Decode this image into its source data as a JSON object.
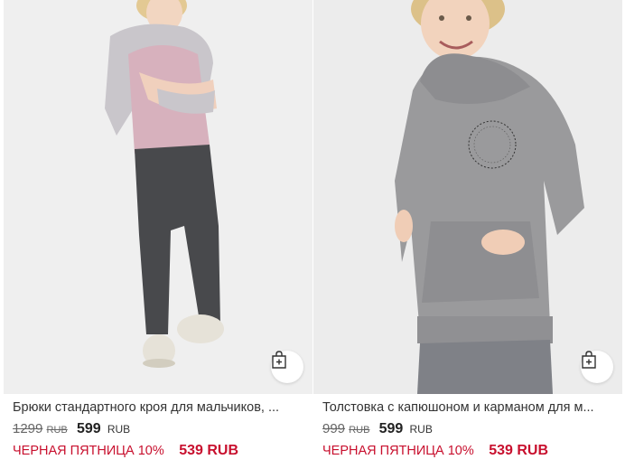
{
  "products": [
    {
      "title": "Брюки стандартного кроя для мальчиков, ...",
      "old_price": "1299",
      "old_currency": "RUB",
      "price": "599",
      "currency": "RUB",
      "promo_label": "ЧЕРНАЯ ПЯТНИЦА 10%",
      "promo_price": "539 RUB",
      "image_alt": "boy-in-pink-polo-and-dark-trousers"
    },
    {
      "title": "Толстовка с капюшоном и карманом для м...",
      "old_price": "999",
      "old_currency": "RUB",
      "price": "599",
      "currency": "RUB",
      "promo_label": "ЧЕРНАЯ ПЯТНИЦА 10%",
      "promo_price": "539 RUB",
      "image_alt": "boy-in-grey-hoodie"
    }
  ],
  "colors": {
    "promo": "#c8102e",
    "image_bg": "#efefef"
  },
  "icons": {
    "add_to_cart": "shopping-bag-plus-icon"
  }
}
